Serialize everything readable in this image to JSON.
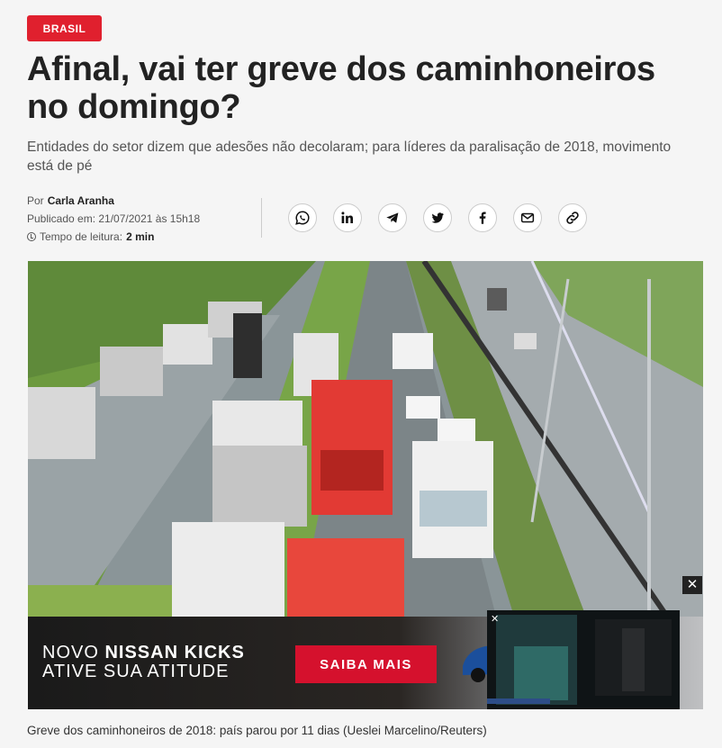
{
  "section_badge": "BRASIL",
  "article": {
    "title": "Afinal, vai ter greve dos caminhoneiros no domingo?",
    "subtitle": "Entidades do setor dizem que adesões não decolaram; para líderes da paralisação de 2018, movimento está de pé",
    "by_prefix": "Por",
    "author": "Carla Aranha",
    "published": "Publicado em: 21/07/2021 às 15h18",
    "read_time_label": "Tempo de leitura:",
    "read_time_value": "2 min"
  },
  "share_icons": [
    "whatsapp-icon",
    "linkedin-icon",
    "telegram-icon",
    "twitter-icon",
    "facebook-icon",
    "email-icon",
    "link-icon"
  ],
  "ad": {
    "line1_a": "NOVO",
    "line1_b": "NISSAN KICKS",
    "line2": "ATIVE SUA ATITUDE",
    "cta": "SAIBA MAIS",
    "close_label": "✕"
  },
  "video_close": "✕",
  "photo_caption": "Greve dos caminhoneiros de 2018: país parou por 11 dias (Ueslei Marcelino/Reuters)",
  "colors": {
    "accent": "#e0202e",
    "ad_cta": "#d5112d"
  }
}
